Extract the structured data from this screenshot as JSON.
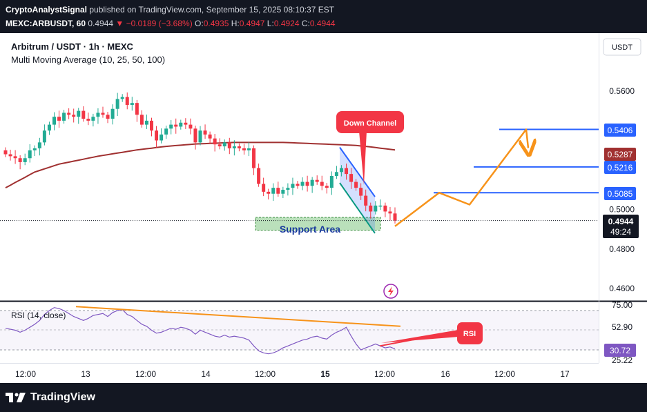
{
  "header": {
    "publisher": "CryptoAnalystSignal",
    "published_text": "published on TradingView.com, September 15, 2025 08:10:37 EST",
    "symbol": "MEXC:ARBUSDT, 60",
    "last": "0.4944",
    "change": "▼ −0.0189 (−3.68%)",
    "o_label": "O:",
    "o": "0.4935",
    "h_label": "H:",
    "h": "0.4947",
    "l_label": "L:",
    "l": "0.4924",
    "c_label": "C:",
    "c": "0.4944"
  },
  "legend": {
    "title": "Arbitrum / USDT · 1h · MEXC",
    "indicator": "Multi Moving Average (10, 25, 50, 100)",
    "rsi": "RSI (14, close)"
  },
  "currency_button": "USDT",
  "annotations": {
    "down_channel": "Down Channel",
    "support_area": "Support Area",
    "rsi_callout": "RSI"
  },
  "price_labels": {
    "level_high": "0.5406",
    "ma_value": "0.5287",
    "level_mid": "0.5216",
    "level_low": "0.5085",
    "current": "0.4944",
    "countdown": "49:24"
  },
  "rsi_labels": {
    "current": "30.72"
  },
  "footer": {
    "brand": "TradingView"
  },
  "colors": {
    "up": "#22ab94",
    "down": "#f23645",
    "ma": "#a03030",
    "level": "#2962ff",
    "projection": "#f7931a",
    "rsi_line": "#7e57c2",
    "rsi_trend": "#f7931a",
    "callout": "#f23645",
    "support": "#81c784"
  },
  "chart_data": [
    {
      "type": "candlestick",
      "title": "Arbitrum / USDT · 1h · MEXC",
      "y_axis_ticks": [
        0.56,
        0.52,
        0.5,
        0.48,
        0.46
      ],
      "y_axis_tick_labels": [
        "0.5600",
        "0.5200",
        "0.5000",
        "0.4800",
        "0.4600"
      ],
      "ylim": [
        0.4545,
        0.5745
      ],
      "x_axis_tick_labels": [
        "12:00",
        "13",
        "12:00",
        "14",
        "12:00",
        "15",
        "12:00",
        "16",
        "12:00",
        "17"
      ],
      "closes": [
        0.528,
        0.527,
        0.526,
        0.524,
        0.526,
        0.53,
        0.531,
        0.534,
        0.54,
        0.543,
        0.547,
        0.545,
        0.549,
        0.548,
        0.547,
        0.55,
        0.546,
        0.545,
        0.547,
        0.549,
        0.548,
        0.546,
        0.551,
        0.556,
        0.557,
        0.553,
        0.554,
        0.548,
        0.543,
        0.545,
        0.54,
        0.535,
        0.538,
        0.541,
        0.543,
        0.542,
        0.544,
        0.543,
        0.541,
        0.534,
        0.54,
        0.538,
        0.536,
        0.533,
        0.532,
        0.534,
        0.531,
        0.532,
        0.531,
        0.53,
        0.531,
        0.521,
        0.513,
        0.509,
        0.508,
        0.511,
        0.508,
        0.51,
        0.511,
        0.513,
        0.512,
        0.514,
        0.512,
        0.515,
        0.514,
        0.512,
        0.511,
        0.517,
        0.519,
        0.521,
        0.518,
        0.514,
        0.511,
        0.507,
        0.502,
        0.499,
        0.502,
        0.502,
        0.499,
        0.498,
        0.4944
      ],
      "ma_100": [
        0.511,
        0.5123,
        0.5137,
        0.515,
        0.5163,
        0.5177,
        0.519,
        0.5198,
        0.5206,
        0.5214,
        0.5222,
        0.523,
        0.5235,
        0.524,
        0.5245,
        0.525,
        0.5255,
        0.526,
        0.5265,
        0.527,
        0.5274,
        0.5278,
        0.5282,
        0.5286,
        0.529,
        0.5294,
        0.5298,
        0.5302,
        0.5305,
        0.5308,
        0.5311,
        0.5314,
        0.5317,
        0.532,
        0.5322,
        0.5324,
        0.5326,
        0.5328,
        0.533,
        0.5332,
        0.5333,
        0.5334,
        0.5335,
        0.5336,
        0.5337,
        0.5338,
        0.5339,
        0.534,
        0.534,
        0.534,
        0.534,
        0.534,
        0.534,
        0.534,
        0.534,
        0.534,
        0.534,
        0.534,
        0.5339,
        0.5338,
        0.5337,
        0.5336,
        0.5335,
        0.5334,
        0.5333,
        0.5332,
        0.5331,
        0.533,
        0.5329,
        0.5328,
        0.5327,
        0.5326,
        0.5325,
        0.5322,
        0.532,
        0.5317,
        0.5314,
        0.5311,
        0.5308,
        0.5305,
        0.5302
      ],
      "horizontal_levels": [
        0.5406,
        0.5216,
        0.5085
      ],
      "support_area": [
        0.4895,
        0.496
      ],
      "projection_path": [
        0.4915,
        0.5085,
        0.5025,
        0.5406
      ],
      "down_channel": {
        "upper": [
          0.5315,
          0.5065
        ],
        "lower": [
          0.5135,
          0.488
        ]
      }
    },
    {
      "type": "line",
      "title": "RSI (14, close)",
      "y_axis_tick_labels": [
        "75.00",
        "52.90",
        "25.22"
      ],
      "ylim": [
        20,
        80
      ],
      "reference_lines": [
        70,
        50,
        30
      ],
      "values": [
        52,
        51,
        50,
        48,
        50,
        53,
        56,
        60,
        66,
        70,
        73,
        72,
        70,
        67,
        64,
        62,
        60,
        62,
        65,
        66,
        67,
        64,
        68,
        70,
        71,
        66,
        64,
        60,
        56,
        54,
        50,
        47,
        48,
        50,
        52,
        51,
        53,
        52,
        50,
        46,
        50,
        48,
        46,
        44,
        43,
        45,
        43,
        44,
        43,
        42,
        40,
        34,
        29,
        27,
        26,
        27,
        29,
        32,
        34,
        36,
        38,
        40,
        41,
        43,
        44,
        42,
        41,
        45,
        48,
        50,
        53,
        44,
        36,
        30,
        32,
        34,
        36,
        34,
        32,
        33,
        31
      ],
      "trendline": [
        74,
        54
      ],
      "callout_line": [
        34,
        49
      ]
    }
  ]
}
